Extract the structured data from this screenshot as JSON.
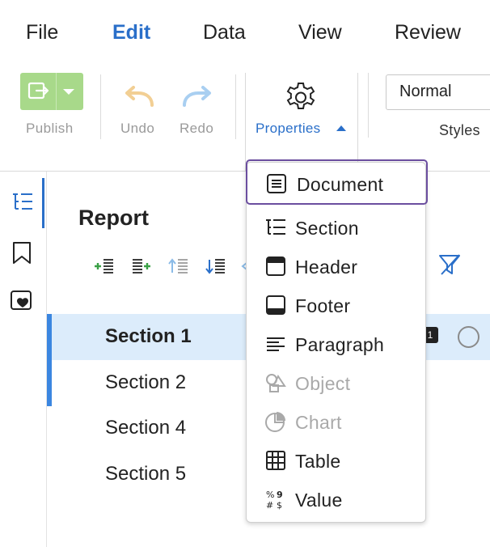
{
  "menu": {
    "items": [
      {
        "label": "File",
        "active": false
      },
      {
        "label": "Edit",
        "active": true
      },
      {
        "label": "Data",
        "active": false
      },
      {
        "label": "View",
        "active": false
      },
      {
        "label": "Review",
        "active": false
      }
    ]
  },
  "toolbar": {
    "publish_label": "Publish",
    "undo_label": "Undo",
    "redo_label": "Redo",
    "properties_label": "Properties",
    "style_value": "Normal",
    "styles_label": "Styles"
  },
  "panel": {
    "title": "Report",
    "sections": [
      {
        "label": "Section 1",
        "selected": true
      },
      {
        "label": "Section 2",
        "selected": false
      },
      {
        "label": "Section 4",
        "selected": false
      },
      {
        "label": "Section 5",
        "selected": false
      }
    ],
    "badge_text": "1"
  },
  "dropdown": {
    "items": [
      {
        "label": "Document",
        "icon": "document-icon",
        "disabled": false,
        "highlighted": true
      },
      {
        "label": "Section",
        "icon": "section-icon",
        "disabled": false,
        "highlighted": false
      },
      {
        "label": "Header",
        "icon": "header-icon",
        "disabled": false,
        "highlighted": false
      },
      {
        "label": "Footer",
        "icon": "footer-icon",
        "disabled": false,
        "highlighted": false
      },
      {
        "label": "Paragraph",
        "icon": "paragraph-icon",
        "disabled": false,
        "highlighted": false
      },
      {
        "label": "Object",
        "icon": "object-icon",
        "disabled": true,
        "highlighted": false
      },
      {
        "label": "Chart",
        "icon": "chart-icon",
        "disabled": true,
        "highlighted": false
      },
      {
        "label": "Table",
        "icon": "table-icon",
        "disabled": false,
        "highlighted": false
      },
      {
        "label": "Value",
        "icon": "value-icon",
        "disabled": false,
        "highlighted": false
      }
    ]
  },
  "colors": {
    "accent": "#2a6fc9",
    "selection_bg": "#dcecfb",
    "publish_green": "#a8d98a",
    "highlight_border": "#6b4e9f"
  }
}
